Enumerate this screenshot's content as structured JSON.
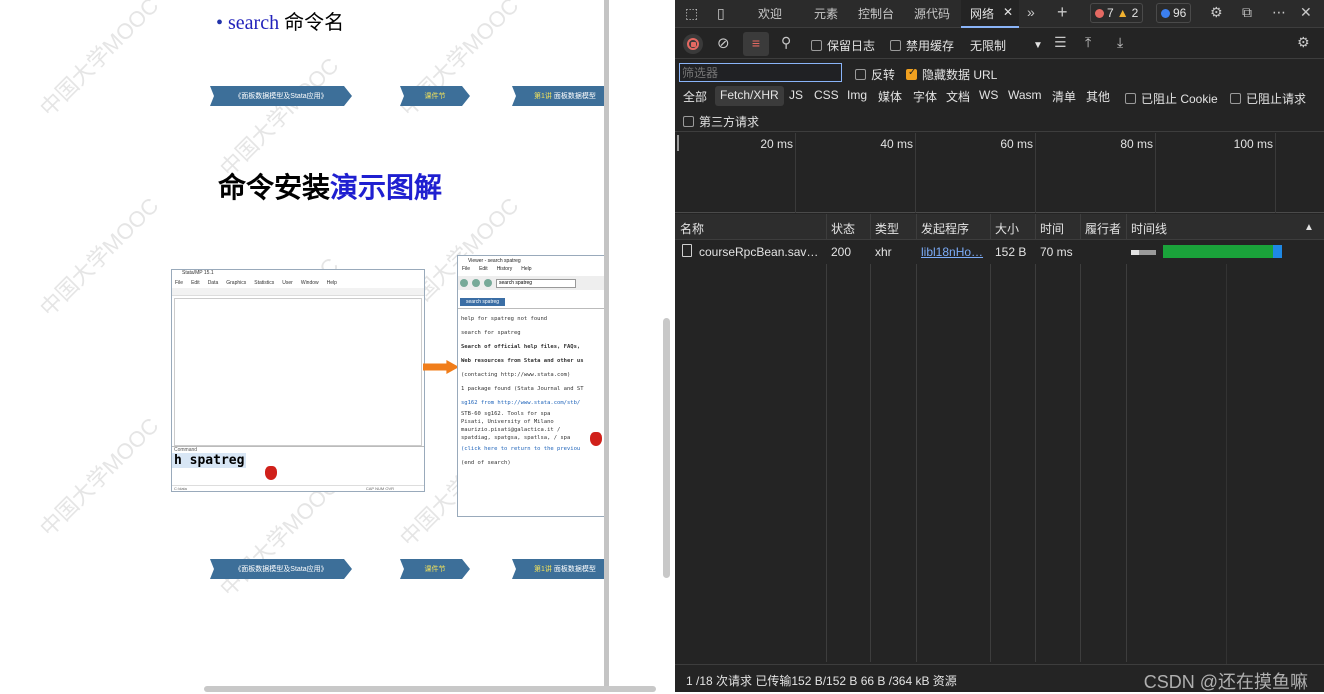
{
  "slide": {
    "bullet_dot": "•",
    "bullet_keyword": "search",
    "bullet_text": "命令名",
    "nav_top": {
      "course": "《面板数据模型及Stata应用》",
      "chapter": "课件节",
      "lecture": "第1讲",
      "lecture_rest": "面板数据模型"
    },
    "nav_bottom": {
      "course": "《面板数据模型及Stata应用》",
      "chapter": "课件节",
      "lecture": "第1讲",
      "lecture_rest": "面板数据模型"
    },
    "title_black": "命令安装",
    "title_blue": "演示图解",
    "watermark": "中国大学MOOC"
  },
  "stata_window": {
    "title": "Stata/MP 15.1",
    "menu": [
      "File",
      "Edit",
      "Data",
      "Graphics",
      "Statistics",
      "User",
      "Window",
      "Help"
    ],
    "command_label": "Command",
    "command_text": "h spatreg",
    "status": "C:\\data",
    "status_right": "CAP NUM OVR"
  },
  "viewer_window": {
    "title": "Viewer - search spatreg",
    "menu": [
      "File",
      "Edit",
      "History",
      "Help"
    ],
    "search_box": "search spatreg",
    "tab": "search spatreg",
    "lines": [
      {
        "text": "help for spatreg not found",
        "style": ""
      },
      {
        "text": "search for spatreg",
        "style": ""
      },
      {
        "text": "Search of official help files, FAQs,",
        "style": "bold"
      },
      {
        "text": "Web resources from Stata and other us",
        "style": "bold"
      },
      {
        "text": "(contacting http://www.stata.com)",
        "style": ""
      },
      {
        "text": "1 package found (Stata Journal and ST",
        "style": ""
      },
      {
        "text": "sg162 from http://www.stata.com/stb/",
        "style": "link"
      },
      {
        "text": "   STB-60 sg162. Tools for spa",
        "style": ""
      },
      {
        "text": "   Pisati, University of Milano",
        "style": ""
      },
      {
        "text": "   maurizio.pisati@galactica.it / ",
        "style": ""
      },
      {
        "text": "   spatdiag, spatgsa, spatlsa, / spa",
        "style": ""
      },
      {
        "text": "(click here to return to the previou",
        "style": "link"
      },
      {
        "text": "(end of search)",
        "style": ""
      }
    ]
  },
  "devtools": {
    "tabs": [
      "欢迎",
      "元素",
      "控制台",
      "源代码",
      "网络"
    ],
    "active_tab": "网络",
    "errors": "7",
    "warnings": "2",
    "messages": "96",
    "toolbar": {
      "preserve_log": "保留日志",
      "disable_cache": "禁用缓存",
      "throttle": "无限制"
    },
    "filter": {
      "placeholder": "筛选器",
      "invert": "反转",
      "hide_data_urls": "隐藏数据 URL"
    },
    "type_filters": [
      "全部",
      "Fetch/XHR",
      "JS",
      "CSS",
      "Img",
      "媒体",
      "字体",
      "文档",
      "WS",
      "Wasm",
      "清单",
      "其他"
    ],
    "active_type": "Fetch/XHR",
    "blocked_cookies": "已阻止 Cookie",
    "blocked_requests": "已阻止请求",
    "third_party": "第三方请求",
    "overview_ticks": [
      "20 ms",
      "40 ms",
      "60 ms",
      "80 ms",
      "100 ms"
    ],
    "columns": [
      "名称",
      "状态",
      "类型",
      "发起程序",
      "大小",
      "时间",
      "履行者",
      "时间线"
    ],
    "sort_arrow": "▲",
    "rows": [
      {
        "name": "courseRpcBean.sav…",
        "status": "200",
        "type": "xhr",
        "initiator": "libl18nHo…",
        "size": "152 B",
        "time": "70 ms",
        "fulfilled": ""
      }
    ],
    "status_bar": "1 /18 次请求  已传输152 B/152 B  66 B /364 kB 资源"
  },
  "csdn_watermark": "CSDN @还在摸鱼嘛"
}
